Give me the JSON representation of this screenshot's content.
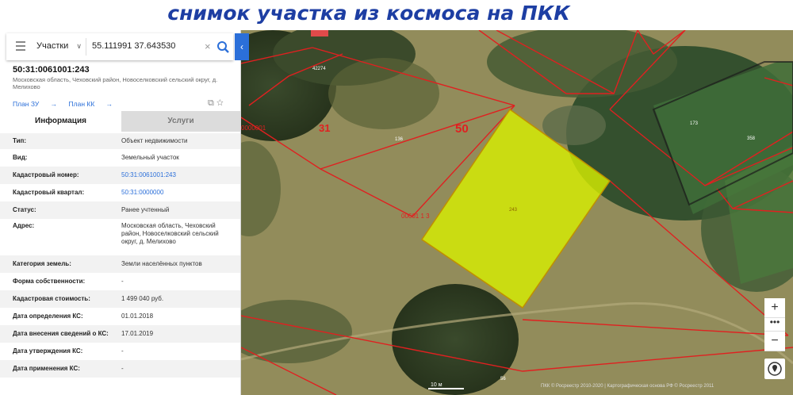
{
  "banner": {
    "title": "снимок участка из космоса на ПКК"
  },
  "search": {
    "category": "Участки",
    "query": "55.111991 37.643530"
  },
  "object": {
    "cadastral_number": "50:31:0061001:243",
    "address_short": "Московская область, Чеховский район, Новоселковский сельский округ, д. Мелихово",
    "link_plan_zu": "План ЗУ",
    "link_plan_kk": "План КК"
  },
  "tabs": {
    "info": "Информация",
    "services": "Услуги"
  },
  "details": [
    {
      "key": "Тип:",
      "value": "Объект недвижимости",
      "link": false
    },
    {
      "key": "Вид:",
      "value": "Земельный участок",
      "link": false
    },
    {
      "key": "Кадастровый номер:",
      "value": "50:31:0061001:243",
      "link": true
    },
    {
      "key": "Кадастровый квартал:",
      "value": "50:31:0000000",
      "link": true
    },
    {
      "key": "Статус:",
      "value": "Ранее учтенный",
      "link": false
    },
    {
      "key": "Адрес:",
      "value": "Московская область, Чеховский район, Новоселковский сельский округ, д. Мелихово",
      "link": false
    },
    {
      "key": "Категория земель:",
      "value": "Земли населённых пунктов",
      "link": false
    },
    {
      "key": "Форма собственности:",
      "value": "-",
      "link": false
    },
    {
      "key": "Кадастровая стоимость:",
      "value": "1 499 040 руб.",
      "link": false
    },
    {
      "key": "Дата определения КС:",
      "value": "01.01.2018",
      "link": false
    },
    {
      "key": "Дата внесения сведений о КС:",
      "value": "17.01.2019",
      "link": false
    },
    {
      "key": "Дата утверждения КС:",
      "value": "-",
      "link": false
    },
    {
      "key": "Дата применения КС:",
      "value": "-",
      "link": false
    }
  ],
  "map": {
    "labels": {
      "l31": "31",
      "l50": "50",
      "l136": "136",
      "l42274": "42274",
      "l173": "173",
      "l358": "358",
      "l243": "243",
      "l0060113": "00601 1 3",
      "l56": "56",
      "l0000001": "0000001"
    },
    "scale": "10 м",
    "copyright": "ПКК © Росреестр 2010-2020 | Картографическая основа РФ © Росреестр 2011",
    "highlight_color": "#d8f000",
    "boundary_color": "#e02020"
  }
}
